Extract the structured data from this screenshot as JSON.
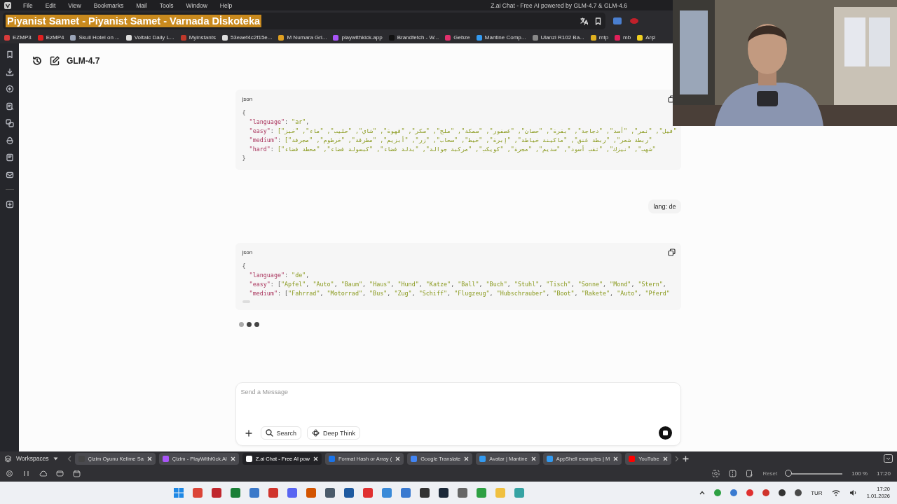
{
  "menu_bar": {
    "items": [
      "File",
      "Edit",
      "View",
      "Bookmarks",
      "Mail",
      "Tools",
      "Window",
      "Help"
    ],
    "title": "Z.ai Chat - Free AI powered by GLM-4.7 & GLM-4.6"
  },
  "address_bar": {
    "value": "Piyanist Samet - Piyanist Samet - Varnada Dİskoteka"
  },
  "bookmarks": [
    {
      "label": "EZMP3",
      "color": "#d83b3b"
    },
    {
      "label": "EzMP4",
      "color": "#e02020"
    },
    {
      "label": "Skull Hotel on ...",
      "color": "#9aa4b8"
    },
    {
      "label": "Voltaic Daily L...",
      "color": "#dddddd"
    },
    {
      "label": "Myinstants",
      "color": "#c0392b"
    },
    {
      "label": "53eaef4c2f15e...",
      "color": "#dddddd"
    },
    {
      "label": "M Numara Gri...",
      "color": "#e0a020"
    },
    {
      "label": "playwithkick.app",
      "color": "#a855f7"
    },
    {
      "label": "Brandfetch - W...",
      "color": "#111111"
    },
    {
      "label": "Gebze",
      "color": "#e1306c"
    },
    {
      "label": "Mantine Comp...",
      "color": "#339af0"
    },
    {
      "label": "Ulanzi R102 Ba...",
      "color": "#888888"
    },
    {
      "label": "mtp",
      "color": "#e0b020"
    },
    {
      "label": "mb",
      "color": "#e0205a"
    },
    {
      "label": "Arşi",
      "color": "#f0d020"
    }
  ],
  "chat": {
    "model": "GLM-4.7",
    "messages": [
      {
        "kind": "code",
        "language": "json",
        "lines": [
          "{",
          "  \"language\": \"ar\",",
          "  \"easy\": [\"فيل\", \"نمر\", \"أسد\", \"دجاجة\", \"بقرة\", \"حصان\", \"عصفور\", \"سمكة\", \"ملح\", \"سكر\", \"قهوة\", \"شاي\", \"حليب\", \"ماء\", \"خبز\"",
          "  \"medium\": [\"ربطة شعر\", \"ربطة عنق\", \"ماكينة خياطة\", \"إبرة\", \"خيط\", \"سحاب\", \"زر\", \"أبزيم\", \"مطرقة\", \"خرطوم\", \"مجرفة\"",
          "  \"hard\": [\"شهب\", \"نيزك\", \"ثقب أسود\", \"سديم\", \"مجرة\", \"كويكب\", \"مركبة جوالة\", \"بدلة فضاء\", \"كبسولة فضاء\", \"محطة فضاء\"",
          "}"
        ]
      },
      {
        "kind": "user",
        "text": "lang: de"
      },
      {
        "kind": "code",
        "language": "json",
        "lines": [
          "{",
          "  \"language\": \"de\",",
          "  \"easy\": [\"Apfel\", \"Auto\", \"Baum\", \"Haus\", \"Hund\", \"Katze\", \"Ball\", \"Buch\", \"Stuhl\", \"Tisch\", \"Sonne\", \"Mond\", \"Stern\",",
          "  \"medium\": [\"Fahrrad\", \"Motorrad\", \"Bus\", \"Zug\", \"Schiff\", \"Flugzeug\", \"Hubschrauber\", \"Boot\", \"Rakete\", \"Auto\", \"Pferd\""
        ]
      }
    ],
    "loading": true,
    "composer": {
      "placeholder": "Send a Message",
      "tools": [
        {
          "kind": "search",
          "label": "Search"
        },
        {
          "kind": "think",
          "label": "Deep Think"
        }
      ]
    }
  },
  "workspaces": "Workspaces",
  "tabs": [
    {
      "label": "Çizim Oyunu Kelime Sa",
      "selected": false,
      "color": "#444444"
    },
    {
      "label": "Çizim - PlayWithKick.Al",
      "selected": false,
      "color": "#a855f7"
    },
    {
      "label": "Z.ai Chat - Free AI pow",
      "selected": true,
      "color": "#ffffff"
    },
    {
      "label": "Format Hash or Array (",
      "selected": false,
      "color": "#1a73e8"
    },
    {
      "label": "Google Translate",
      "selected": false,
      "color": "#4285f4"
    },
    {
      "label": "Avatar | Mantine",
      "selected": false,
      "color": "#339af0"
    },
    {
      "label": "AppShell examples | M",
      "selected": false,
      "color": "#339af0"
    },
    {
      "label": "YouTube",
      "selected": false,
      "color": "#ff0000"
    }
  ],
  "status_bar": {
    "reset": "Reset",
    "zoom": {
      "level": 0.03,
      "reading": "100 %"
    },
    "time": "17:20"
  },
  "taskbar": {
    "language": "TUR",
    "time": "17:20",
    "date": "1.01.2026"
  }
}
